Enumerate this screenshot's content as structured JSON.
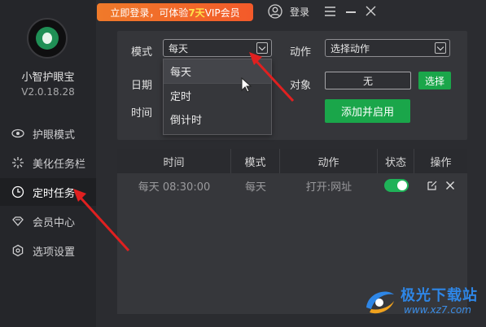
{
  "app": {
    "name": "小智护眼宝",
    "version": "V2.0.18.28"
  },
  "topbar": {
    "promo_prefix": "立即登录，可体验",
    "promo_highlight": "7天",
    "promo_suffix": "VIP会员",
    "login_label": "登录"
  },
  "sidebar": {
    "items": [
      {
        "label": "护眼模式",
        "icon": "eye-icon"
      },
      {
        "label": "美化任务栏",
        "icon": "sparkle-icon"
      },
      {
        "label": "定时任务",
        "icon": "clock-icon",
        "active": true
      },
      {
        "label": "会员中心",
        "icon": "diamond-icon"
      },
      {
        "label": "选项设置",
        "icon": "settings-hex-icon"
      }
    ]
  },
  "form": {
    "mode_label": "模式",
    "mode_value": "每天",
    "date_label": "日期",
    "time_label": "时间",
    "action_label": "动作",
    "action_value": "选择动作",
    "target_label": "对象",
    "target_value": "无",
    "choose_button": "选择",
    "add_button": "添加并启用"
  },
  "dropdown": {
    "options": [
      "每天",
      "定时",
      "倒计时"
    ],
    "hovered": "每天"
  },
  "table": {
    "headers": [
      "时间",
      "模式",
      "动作",
      "状态",
      "操作"
    ],
    "rows": [
      {
        "time": "每天 08:30:00",
        "mode": "每天",
        "action": "打开:网址",
        "enabled": true
      }
    ]
  },
  "watermark": {
    "title": "极光下载站",
    "url": "www.xz7.com"
  },
  "colors": {
    "accent": "#1aa64a",
    "promo": "#f36a2a",
    "annotation_arrow": "#e02020"
  }
}
